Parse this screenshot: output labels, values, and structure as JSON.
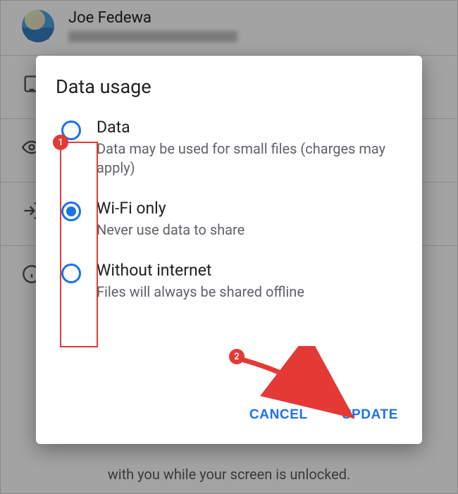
{
  "background": {
    "profile_name": "Joe Fedewa",
    "caption_line1": "with you while your screen is unlocked."
  },
  "dialog": {
    "title": "Data usage",
    "options": [
      {
        "label": "Data",
        "description": "Data may be used for small files (charges may apply)",
        "selected": false
      },
      {
        "label": "Wi-Fi only",
        "description": "Never use data to share",
        "selected": true
      },
      {
        "label": "Without internet",
        "description": "Files will always be shared offline",
        "selected": false
      }
    ],
    "actions": {
      "cancel": "CANCEL",
      "update": "UPDATE"
    }
  },
  "annotations": {
    "badge1": "1",
    "badge2": "2"
  },
  "colors": {
    "accent": "#1a73e8",
    "annotation": "#e53935"
  }
}
